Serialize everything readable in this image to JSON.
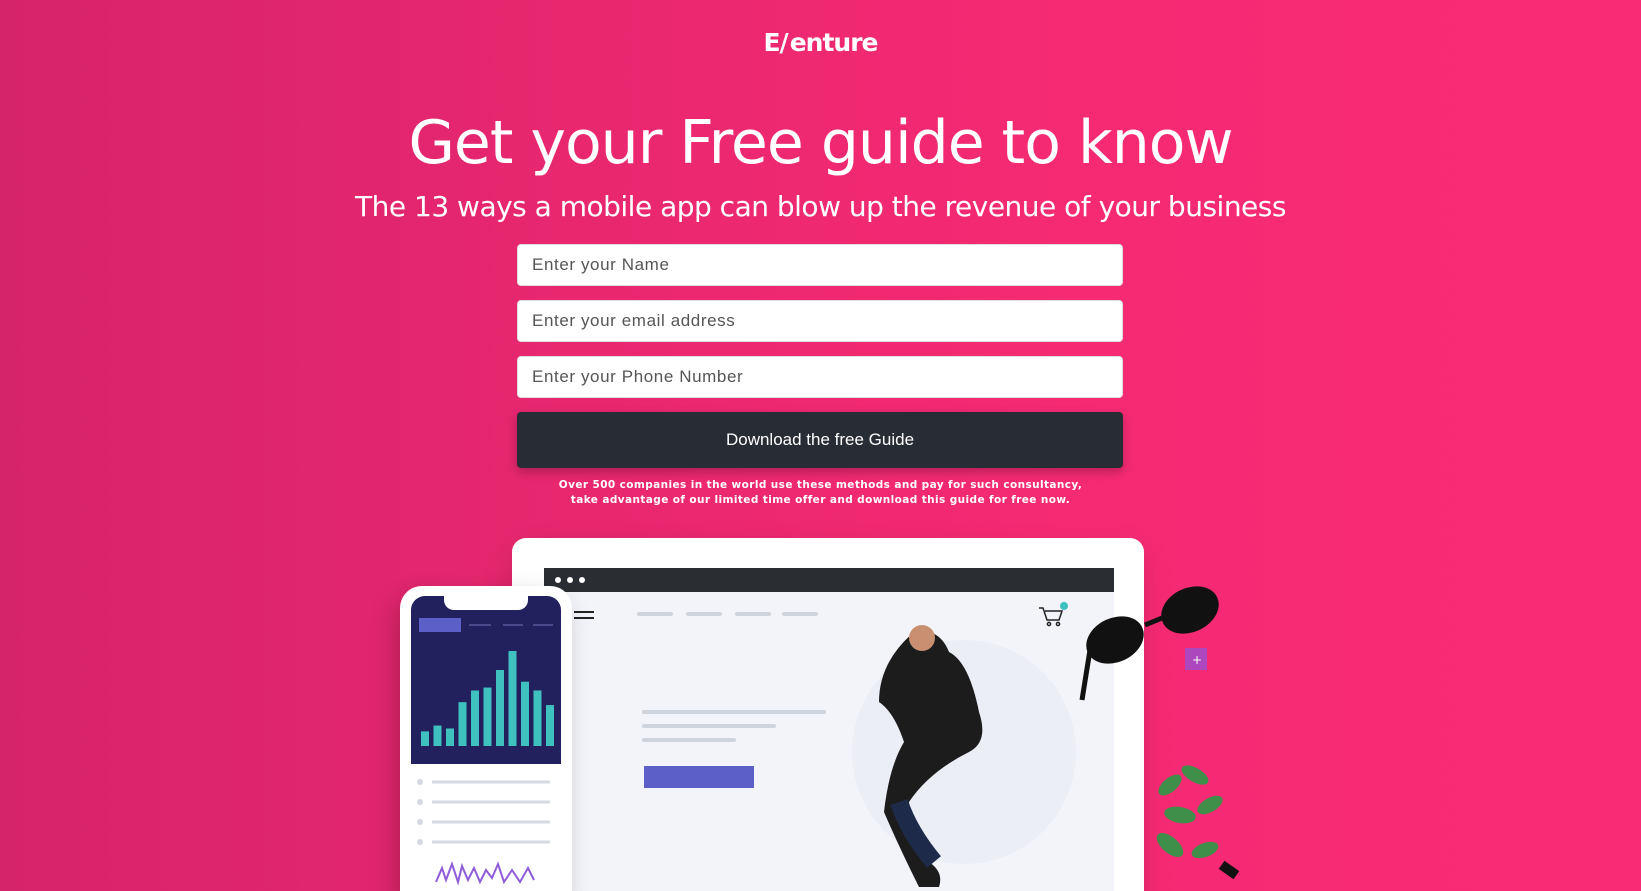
{
  "brand": {
    "logo_text": "enture",
    "logo_mark": "E/"
  },
  "hero": {
    "headline": "Get your Free guide to know",
    "subheadline": "The 13 ways a mobile app can blow up the revenue of your business"
  },
  "form": {
    "name_placeholder": "Enter your Name",
    "email_placeholder": "Enter your email address",
    "phone_placeholder": "Enter your Phone Number",
    "submit_label": "Download the free Guide"
  },
  "fineprint": {
    "line1": "Over 500 companies in the world use these methods and pay for such consultancy,",
    "line2": "take advantage of our limited time offer and download this guide for free now."
  },
  "illustration": {
    "bar_chart_values": [
      10,
      14,
      12,
      30,
      38,
      40,
      52,
      65,
      44,
      38,
      28
    ],
    "colors": {
      "phone_screen": "#23205e",
      "bars": "#3fc1c0",
      "cta": "#5b5fc7"
    }
  },
  "colors": {
    "accent": "#f52a73",
    "button": "#282c34"
  }
}
